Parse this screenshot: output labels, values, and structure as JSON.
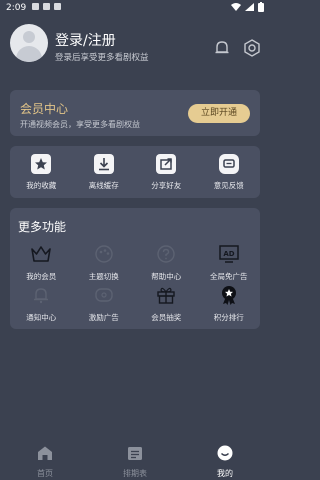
{
  "status": {
    "time": "2:09"
  },
  "profile": {
    "title": "登录/注册",
    "subtitle": "登录后享受更多看剧权益"
  },
  "vip": {
    "title": "会员中心",
    "subtitle": "开通视频会员，享受更多看剧权益",
    "button": "立即开通"
  },
  "quick": [
    {
      "label": "我的收藏",
      "icon": "star-icon"
    },
    {
      "label": "离线缓存",
      "icon": "download-icon"
    },
    {
      "label": "分享好友",
      "icon": "share-icon"
    },
    {
      "label": "意见反馈",
      "icon": "feedback-icon"
    }
  ],
  "more": {
    "title": "更多功能",
    "items": [
      {
        "label": "我的会员",
        "icon": "crown-icon"
      },
      {
        "label": "主题切换",
        "icon": "theme-icon"
      },
      {
        "label": "帮助中心",
        "icon": "help-icon"
      },
      {
        "label": "全局免广告",
        "icon": "ad-icon"
      },
      {
        "label": "通知中心",
        "icon": "bell-icon"
      },
      {
        "label": "激励广告",
        "icon": "reward-ad-icon"
      },
      {
        "label": "会员抽奖",
        "icon": "gift-icon"
      },
      {
        "label": "积分排行",
        "icon": "medal-icon"
      }
    ]
  },
  "tabs": [
    {
      "label": "首页",
      "icon": "home-icon",
      "active": false
    },
    {
      "label": "排期表",
      "icon": "schedule-icon",
      "active": false
    },
    {
      "label": "我的",
      "icon": "profile-icon",
      "active": true
    }
  ],
  "colors": {
    "background": "#3b4150",
    "card": "#4a5062",
    "vip_accent": "#e3c589",
    "vip_button": "#e6cc92"
  }
}
